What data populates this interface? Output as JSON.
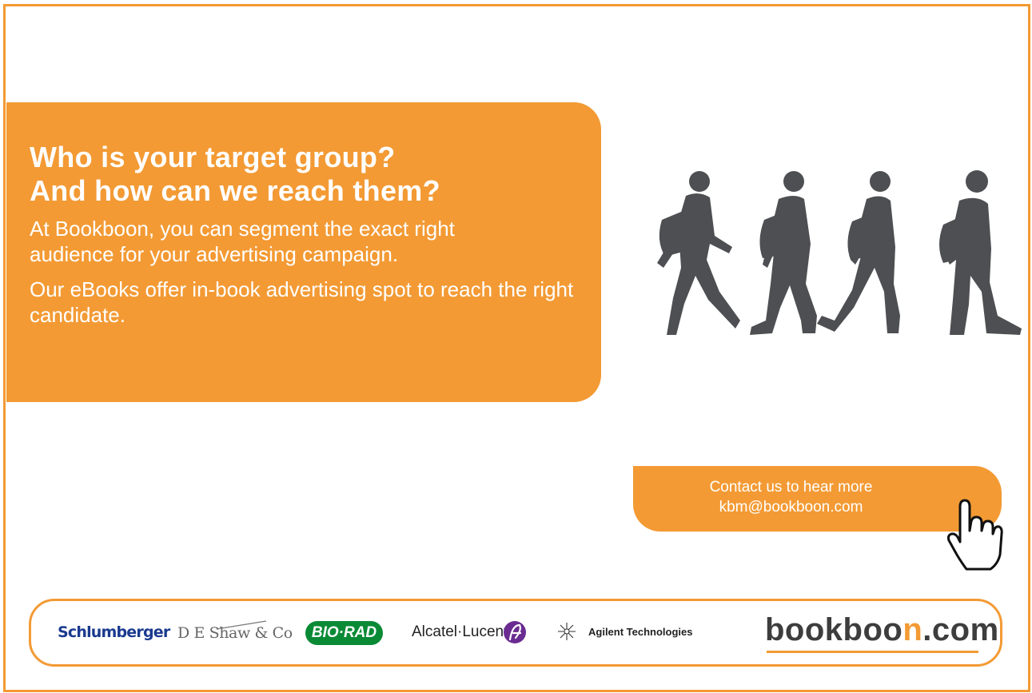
{
  "hero": {
    "title_line1": "Who is your target group?",
    "title_line2": "And how can we reach them?",
    "body1": "At Bookboon, you can segment the exact right audience for your advertising campaign.",
    "body2": "Our eBooks offer in-book advertising spot to reach the right candidate."
  },
  "cta": {
    "line1": "Contact us to hear more",
    "line2": "kbm@bookboon.com"
  },
  "logos": {
    "schlumberger": "Schlumberger",
    "deshaw": "D E Shaw & Co",
    "biorad": "BIO·RAD",
    "alcatel": "Alcatel·Lucent",
    "agilent": "Agilent Technologies",
    "bookboon_pre": "bookboo",
    "bookboon_n": "n",
    "bookboon_post": ".com"
  },
  "icons": {
    "walkers": "walking-people-silhouettes",
    "hand": "pointing-hand-cursor-icon",
    "alcatel": "alcatel-lucent-logo-icon",
    "agilent": "agilent-spark-logo-icon"
  },
  "colors": {
    "accent": "#f39a34",
    "silhouette": "#4d4f52",
    "schlumberger": "#1a3a8f",
    "biorad": "#0a8a35",
    "alcatel": "#6a2c91"
  }
}
